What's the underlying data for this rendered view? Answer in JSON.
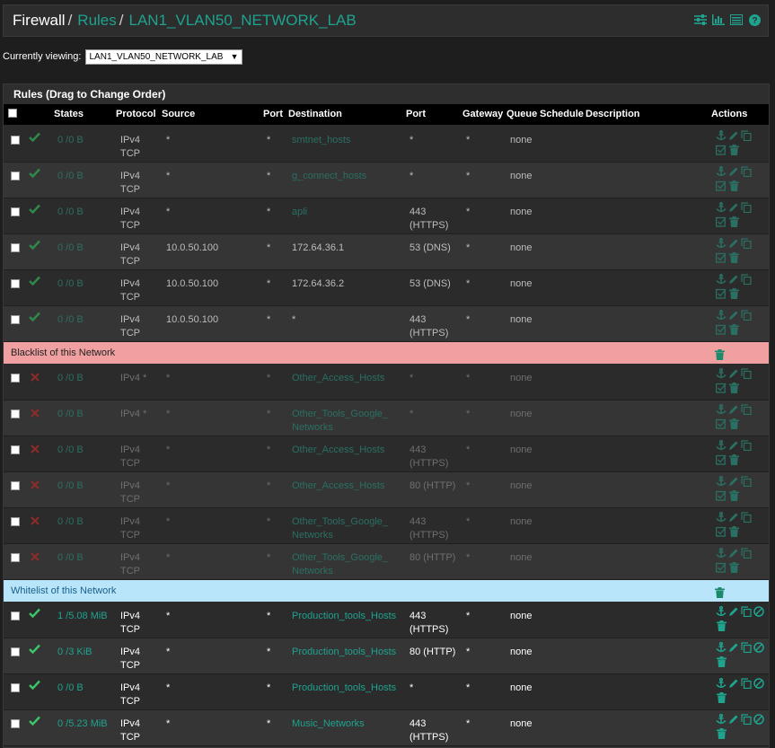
{
  "header": {
    "crumbs": [
      "Firewall",
      "Rules",
      "LAN1_VLAN50_NETWORK_LAB"
    ],
    "icons": [
      "sliders-icon",
      "bar-chart-icon",
      "list-icon",
      "help-icon"
    ]
  },
  "viewing": {
    "label": "Currently viewing:",
    "selected": "LAN1_VLAN50_NETWORK_LAB"
  },
  "panel": {
    "title": "Rules (Drag to Change Order)"
  },
  "columns": [
    "States",
    "Protocol",
    "Source",
    "Port",
    "Destination",
    "Port",
    "Gateway",
    "Queue",
    "Schedule",
    "Description",
    "Actions"
  ],
  "rows": [
    {
      "status": "pass",
      "states": "0 /0 B",
      "protocol": "IPv4\nTCP",
      "source": "*",
      "sport": "*",
      "dest": "smtnet_hosts",
      "dport": "*",
      "gateway": "*",
      "queue": "none",
      "style": "dim"
    },
    {
      "status": "pass",
      "states": "0 /0 B",
      "protocol": "IPv4\nTCP",
      "source": "*",
      "sport": "*",
      "dest": "g_connect_hosts",
      "dport": "*",
      "gateway": "*",
      "queue": "none",
      "style": "dim"
    },
    {
      "status": "pass",
      "states": "0 /0 B",
      "protocol": "IPv4\nTCP",
      "source": "*",
      "sport": "*",
      "dest": "apli",
      "dport": "443\n(HTTPS)",
      "gateway": "*",
      "queue": "none",
      "style": "dim"
    },
    {
      "status": "pass",
      "states": "0 /0 B",
      "protocol": "IPv4\nTCP",
      "source": "10.0.50.100",
      "sport": "*",
      "dest": "172.64.36.1",
      "dport": "53 (DNS)",
      "gateway": "*",
      "queue": "none",
      "style": "dimplain"
    },
    {
      "status": "pass",
      "states": "0 /0 B",
      "protocol": "IPv4\nTCP",
      "source": "10.0.50.100",
      "sport": "*",
      "dest": "172.64.36.2",
      "dport": "53 (DNS)",
      "gateway": "*",
      "queue": "none",
      "style": "dimplain"
    },
    {
      "status": "pass",
      "states": "0 /0 B",
      "protocol": "IPv4\nTCP",
      "source": "10.0.50.100",
      "sport": "*",
      "dest": "*",
      "dport": "443\n(HTTPS)",
      "gateway": "*",
      "queue": "none",
      "style": "dimplain"
    }
  ],
  "blacklist": {
    "label": "Blacklist of this Network"
  },
  "block_rows": [
    {
      "status": "block",
      "states": "0 /0 B",
      "protocol": "IPv4 *",
      "source": "*",
      "sport": "*",
      "dest": "Other_Access_Hosts",
      "dport": "*",
      "gateway": "*",
      "queue": "none"
    },
    {
      "status": "block",
      "states": "0 /0 B",
      "protocol": "IPv4 *",
      "source": "*",
      "sport": "*",
      "dest": "Other_Tools_Google_\nNetworks",
      "dport": "*",
      "gateway": "*",
      "queue": "none"
    },
    {
      "status": "block",
      "states": "0 /0 B",
      "protocol": "IPv4\nTCP",
      "source": "*",
      "sport": "*",
      "dest": "Other_Access_Hosts",
      "dport": "443\n(HTTPS)",
      "gateway": "*",
      "queue": "none"
    },
    {
      "status": "block",
      "states": "0 /0 B",
      "protocol": "IPv4\nTCP",
      "source": "*",
      "sport": "*",
      "dest": "Other_Access_Hosts",
      "dport": "80 (HTTP)",
      "gateway": "*",
      "queue": "none"
    },
    {
      "status": "block",
      "states": "0 /0 B",
      "protocol": "IPv4\nTCP",
      "source": "*",
      "sport": "*",
      "dest": "Other_Tools_Google_\nNetworks",
      "dport": "443\n(HTTPS)",
      "gateway": "*",
      "queue": "none"
    },
    {
      "status": "block",
      "states": "0 /0 B",
      "protocol": "IPv4\nTCP",
      "source": "*",
      "sport": "*",
      "dest": "Other_Tools_Google_\nNetworks",
      "dport": "80 (HTTP)",
      "gateway": "*",
      "queue": "none"
    }
  ],
  "whitelist": {
    "label": "Whitelist of this Network"
  },
  "allow_rows": [
    {
      "status": "pass",
      "states": "1 /5.08 MiB",
      "protocol": "IPv4\nTCP",
      "source": "*",
      "sport": "*",
      "dest": "Production_tools_Hosts",
      "dport": "443\n(HTTPS)",
      "gateway": "*",
      "queue": "none"
    },
    {
      "status": "pass",
      "states": "0 /3 KiB",
      "protocol": "IPv4\nTCP",
      "source": "*",
      "sport": "*",
      "dest": "Production_tools_Hosts",
      "dport": "80 (HTTP)",
      "gateway": "*",
      "queue": "none"
    },
    {
      "status": "pass",
      "states": "0 /0 B",
      "protocol": "IPv4\nTCP",
      "source": "*",
      "sport": "*",
      "dest": "Production_tools_Hosts",
      "dport": "*",
      "gateway": "*",
      "queue": "none"
    },
    {
      "status": "pass",
      "states": "0 /5.23 MiB",
      "protocol": "IPv4\nTCP",
      "source": "*",
      "sport": "*",
      "dest": "Music_Networks",
      "dport": "443\n(HTTPS)",
      "gateway": "*",
      "queue": "none"
    }
  ],
  "colors": {
    "accent": "#1ea38f",
    "block": "#c0392b",
    "blacklist_bg": "#f0a0a0",
    "whitelist_bg": "#b8e5fa"
  }
}
